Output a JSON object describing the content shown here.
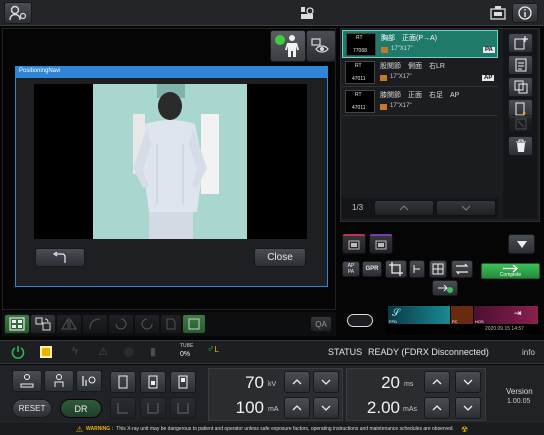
{
  "topbar": {
    "user_icon": "user-settings-icon",
    "patient_icon": "patient-icon",
    "exposure_icon": "exposure-icon",
    "info_icon": "info-icon"
  },
  "view_toggle": {
    "icon_a": "standing-person-icon",
    "icon_b": "eye-view-icon",
    "indicator_color": "#3ccf3c"
  },
  "dialog": {
    "title": "PositioningNavi",
    "title_color": "#2f86d6",
    "back_icon": "return-arrow-icon",
    "close_label": "Close"
  },
  "exam_list": {
    "items": [
      {
        "thumb_top": "RT",
        "thumb_num": "77068",
        "name": "胸部　正面(P→A)",
        "size": "17\"X17\"",
        "tag": "PA",
        "selected": true
      },
      {
        "thumb_top": "RT",
        "thumb_num": "47011",
        "name": "股関節　側面　右LR",
        "size": "17\"X17\"",
        "tag": "AP",
        "selected": false
      },
      {
        "thumb_top": "RT",
        "thumb_num": "47011",
        "name": "膝関節　正面　右足　AP",
        "size": "17\"X17\"",
        "tag": "AP",
        "selected": false
      }
    ],
    "page": "1/3",
    "selected_color": "#1f7a6a",
    "tag_text_color": "#d0d0d0"
  },
  "side_tools": [
    "add-exam-icon",
    "edit-exam-icon",
    "copy-exam-icon",
    "move-exam-icon",
    "disabled-exam-icon",
    "trash-icon"
  ],
  "cassette_tabs": [
    {
      "icon": "cassette-icon",
      "color": "#c0305a"
    },
    {
      "icon": "cassette-icon",
      "color": "#7a3cb0"
    }
  ],
  "image_tools": {
    "ap_label": "AP\nPA",
    "gpr_label": "GPR",
    "complete_label": "Complete",
    "complete_color": "#2fa84a"
  },
  "lut_bar": {
    "labels": [
      "FPD",
      "PC",
      "HOS"
    ],
    "timestamp": "2020.09.15  14:57"
  },
  "status": {
    "label": "STATUS",
    "value": "READY (FDRX Disconnected)",
    "info_label": "info",
    "tube_label": "TUBE",
    "tube_value": "0%",
    "power_color": "#2fb84a",
    "warn_color": "#f0b400"
  },
  "bottom": {
    "reset_label": "RESET",
    "dr_label": "DR",
    "kv_value": "70",
    "kv_unit": "kV",
    "ma_value": "100",
    "ma_unit": "mA",
    "ms_value": "20",
    "ms_unit": "ms",
    "mas_value": "2.00",
    "mas_unit": "mAs",
    "version_label": "Version",
    "version_value": "1.00.05"
  },
  "warning": {
    "text_bold": "WARNING : ",
    "text": "This X-ray unit may be dangerous to patient and operator unless safe exposure factors, operating instructions and maintenance schedules are observed."
  },
  "left_tools": [
    "layout-icon",
    "rotate-image-icon",
    "flip-icon",
    "curve-icon",
    "rotate-left-icon",
    "crop-icon",
    "mask-icon",
    "shutter-icon"
  ],
  "qa_label": "QA"
}
